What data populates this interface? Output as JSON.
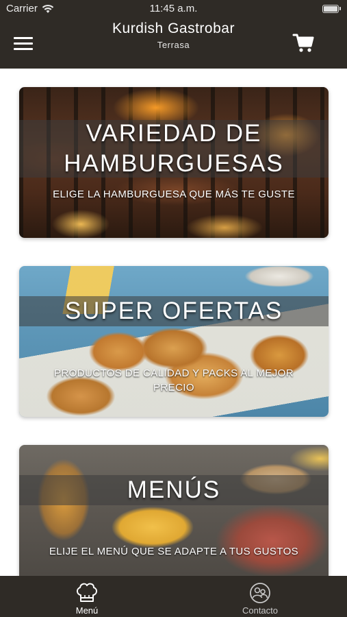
{
  "status_bar": {
    "carrier": "Carrier",
    "time": "11:45 a.m."
  },
  "header": {
    "title": "Kurdish Gastrobar",
    "subtitle": "Terrasa"
  },
  "cards": [
    {
      "title_line1": "VARIEDAD DE",
      "title_line2": "HAMBURGUESAS",
      "subtitle": "ELIGE LA HAMBURGUESA QUE MÁS TE GUSTE"
    },
    {
      "title": "SUPER OFERTAS",
      "subtitle_line1": "PRODUCTOS DE CALIDAD Y PACKS AL MEJOR",
      "subtitle_line2": "PRECIO"
    },
    {
      "title": "MENÚS",
      "subtitle": "ELIJE EL MENÚ QUE SE ADAPTE A TUS GUSTOS"
    }
  ],
  "tabbar": {
    "menu_label": "Menú",
    "contact_label": "Contacto",
    "active_tab": "Menú"
  },
  "colors": {
    "header_bg": "#2f2b26",
    "tabbar_bg": "#2f2b26",
    "text_light": "#ffffff"
  }
}
